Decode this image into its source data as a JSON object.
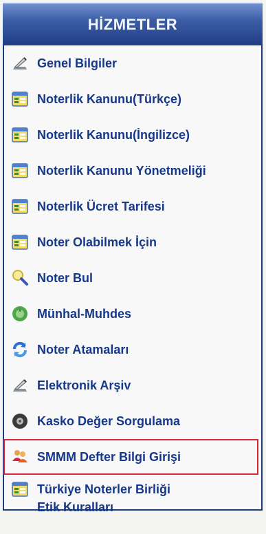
{
  "menu": {
    "title": "HİZMETLER",
    "items": [
      {
        "label": "Genel Bilgiler",
        "icon": "pen-icon"
      },
      {
        "label": "Noterlik Kanunu(Türkçe)",
        "icon": "form-icon"
      },
      {
        "label": "Noterlik Kanunu(İngilizce)",
        "icon": "form-icon"
      },
      {
        "label": "Noterlik Kanunu Yönetmeliği",
        "icon": "form-icon"
      },
      {
        "label": "Noterlik Ücret Tarifesi",
        "icon": "form-icon"
      },
      {
        "label": "Noter Olabilmek İçin",
        "icon": "form-icon"
      },
      {
        "label": "Noter Bul",
        "icon": "magnifier-icon"
      },
      {
        "label": "Münhal-Muhdes",
        "icon": "badge-icon"
      },
      {
        "label": "Noter Atamaları",
        "icon": "refresh-icon"
      },
      {
        "label": "Elektronik Arşiv",
        "icon": "pen-icon"
      },
      {
        "label": "Kasko Değer Sorgulama",
        "icon": "tire-icon"
      },
      {
        "label": "SMMM Defter Bilgi Girişi",
        "icon": "users-icon"
      },
      {
        "label_line1": "Türkiye Noterler Birliği",
        "label_line2": "Etik Kuralları",
        "icon": "form-icon"
      }
    ]
  },
  "colors": {
    "header": "#2b4a96",
    "link": "#16388a",
    "highlight_border": "#d8243c"
  }
}
